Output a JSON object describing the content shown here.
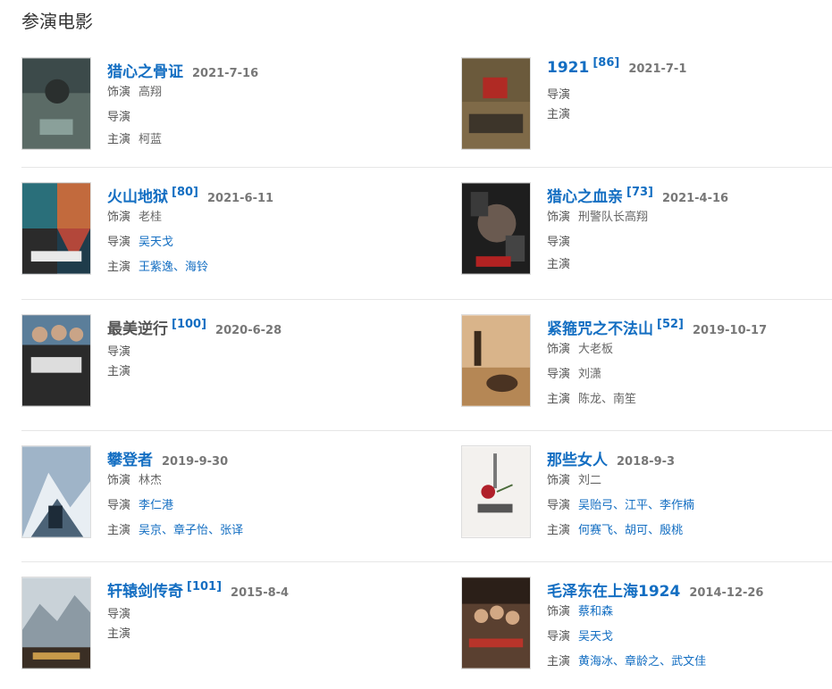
{
  "section": {
    "title": "参演电影"
  },
  "labels": {
    "role": "饰演",
    "director": "导演",
    "cast": "主演"
  },
  "sep": "、",
  "movies": [
    {
      "title": "猎心之骨证",
      "score": "",
      "date": "2021-7-16",
      "role": "高翔",
      "director": "",
      "cast": [
        "柯蓝"
      ],
      "cast_link": false,
      "director_link": false
    },
    {
      "title": "1921",
      "score": "[86]",
      "date": "2021-7-1",
      "role": "",
      "director": "",
      "cast": []
    },
    {
      "title": "火山地狱",
      "score": "[80]",
      "date": "2021-6-11",
      "role": "老桂",
      "director": "吴天戈",
      "cast": [
        "王紫逸",
        "海铃"
      ]
    },
    {
      "title": "猎心之血亲",
      "score": "[73]",
      "date": "2021-4-16",
      "role": "刑警队长高翔",
      "director": "",
      "cast": []
    },
    {
      "title": "最美逆行",
      "score": "[100]",
      "date": "2020-6-28",
      "role": "",
      "director": "",
      "cast": []
    },
    {
      "title": "紧箍咒之不法山",
      "score": "[52]",
      "date": "2019-10-17",
      "role": "大老板",
      "director": "刘潇",
      "cast": [
        "陈龙",
        "南笙"
      ]
    },
    {
      "title": "攀登者",
      "score": "",
      "date": "2019-9-30",
      "role": "林杰",
      "director": "李仁港",
      "cast": [
        "吴京",
        "章子怡",
        "张译"
      ]
    },
    {
      "title": "那些女人",
      "score": "",
      "date": "2018-9-3",
      "role": "刘二",
      "director": "吴贻弓、江平、李作楠",
      "cast": [
        "何赛飞",
        "胡可",
        "殷桃"
      ]
    },
    {
      "title": "轩辕剑传奇",
      "score": "[101]",
      "date": "2015-8-4",
      "role": "",
      "director": "",
      "cast": []
    },
    {
      "title": "毛泽东在上海1924",
      "score": "",
      "date": "2014-12-26",
      "role": "蔡和森",
      "director": "吴天戈",
      "cast": [
        "黄海冰",
        "章龄之",
        "武文佳"
      ]
    }
  ],
  "colors": {
    "link": "#136ec2",
    "date": "#777777",
    "divider": "#e6e6e6"
  }
}
